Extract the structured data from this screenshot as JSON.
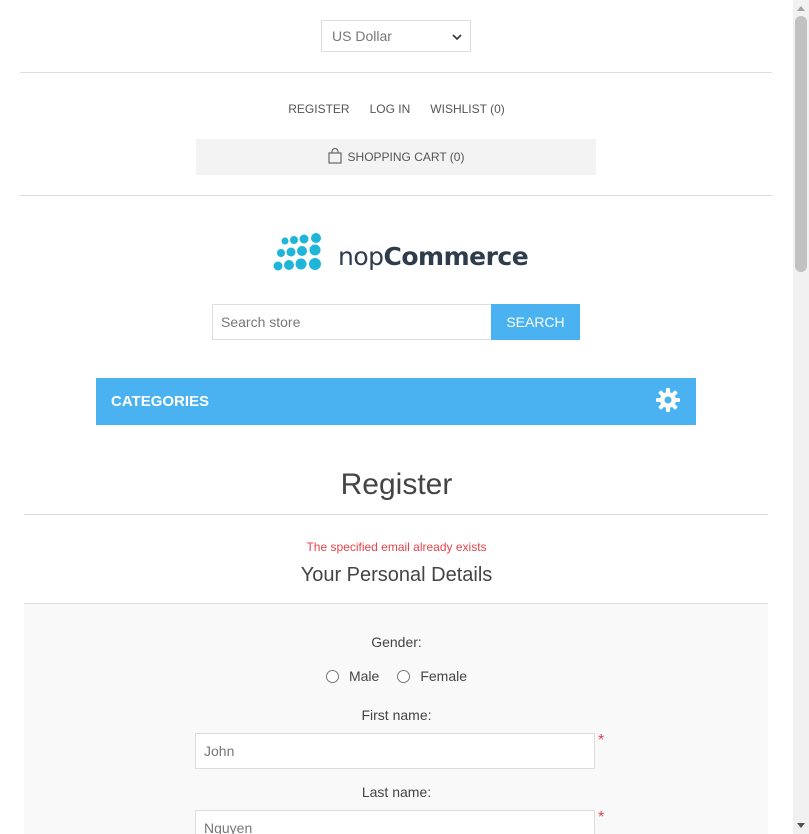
{
  "currency": {
    "selected": "US Dollar"
  },
  "header_links": {
    "register": "REGISTER",
    "login": "LOG IN",
    "wishlist": "WISHLIST (0)"
  },
  "cart": {
    "label": "SHOPPING CART (0)"
  },
  "logo": {
    "text_light": "nop",
    "text_bold": "Commerce",
    "dot_color": "#1fb5d8"
  },
  "search": {
    "placeholder": "Search store",
    "button_label": "SEARCH"
  },
  "categories": {
    "label": "CATEGORIES",
    "icon": "gear-icon"
  },
  "register": {
    "title": "Register",
    "error": "The specified email already exists",
    "section_title": "Your Personal Details",
    "gender_label": "Gender:",
    "gender_options": [
      "Male",
      "Female"
    ],
    "first_name_label": "First name:",
    "first_name_value": "John",
    "last_name_label": "Last name:",
    "last_name_value": "Nguyen",
    "required_mark": "*"
  },
  "colors": {
    "accent": "#4ab2f1",
    "error": "#e4434b"
  }
}
